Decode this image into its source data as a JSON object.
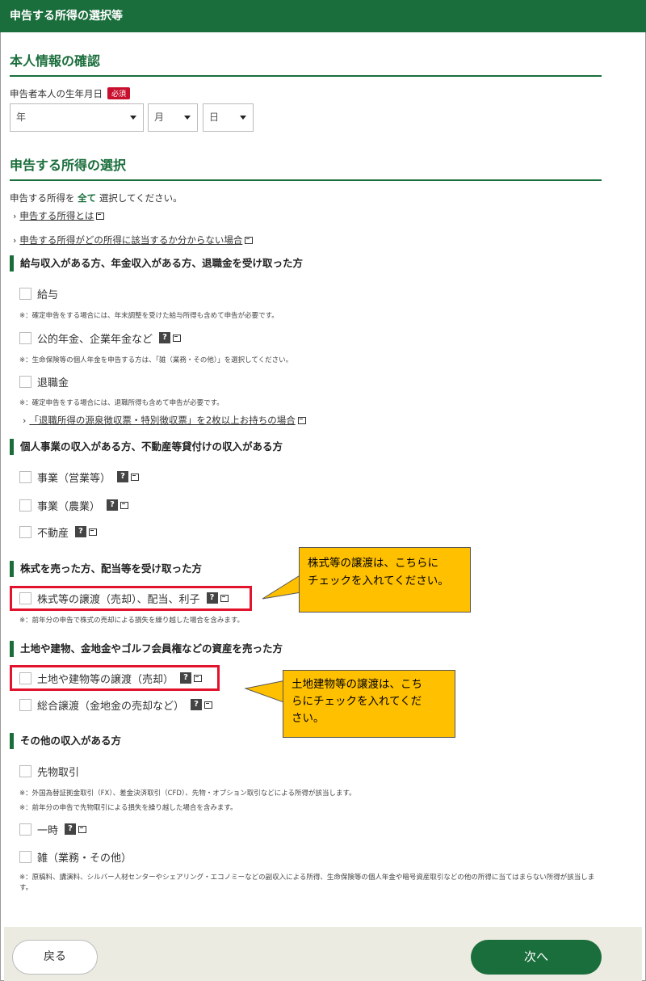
{
  "header": {
    "title": "申告する所得の選択等"
  },
  "personal": {
    "title": "本人情報の確認",
    "birth_label": "申告者本人の生年月日",
    "required_badge": "必須",
    "year_placeholder": "年",
    "month_placeholder": "月",
    "day_placeholder": "日"
  },
  "income_select": {
    "title": "申告する所得の選択",
    "instruction_prefix": "申告する所得を",
    "instruction_emph": "全て",
    "instruction_suffix": "選択してください。",
    "link1": "申告する所得とは",
    "link2": "申告する所得がどの所得に該当するか分からない場合"
  },
  "group1": {
    "heading": "給与収入がある方、年金収入がある方、退職金を受け取った方",
    "items": [
      "給与",
      "公的年金、企業年金など",
      "退職金"
    ],
    "note1": "※：確定申告をする場合には、年末調整を受けた給与所得も含めて申告が必要です。",
    "note2": "※：生命保険等の個人年金を申告する方は、「雑（業務・その他）」を選択してください。",
    "note3": "※：確定申告をする場合には、退職所得も含めて申告が必要です。",
    "link": "「退職所得の源泉徴収票・特別徴収票」を2枚以上お持ちの場合"
  },
  "group2": {
    "heading": "個人事業の収入がある方、不動産等貸付けの収入がある方",
    "items": [
      "事業（営業等）",
      "事業（農業）",
      "不動産"
    ]
  },
  "group3": {
    "heading": "株式を売った方、配当等を受け取った方",
    "items": [
      "株式等の譲渡（売却）、配当、利子"
    ],
    "note": "※：前年分の申告で株式の売却による損失を繰り越した場合を含みます。"
  },
  "group4": {
    "heading": "土地や建物、金地金やゴルフ会員権などの資産を売った方",
    "items": [
      "土地や建物等の譲渡（売却）",
      "総合譲渡（金地金の売却など）"
    ]
  },
  "group5": {
    "heading": "その他の収入がある方",
    "items": [
      "先物取引",
      "一時",
      "雑（業務・その他）"
    ],
    "note1": "※：外国為替証拠金取引（FX）、差金決済取引（CFD）、先物・オプション取引などによる所得が該当します。",
    "note2": "※：前年分の申告で先物取引による損失を繰り越した場合を含みます。",
    "note3": "※：原稿料、講演料、シルバー人材センターやシェアリング・エコノミーなどの副収入による所得、生命保険等の個人年金や暗号資産取引などの他の所得に当てはまらない所得が該当します。"
  },
  "callouts": {
    "stock_line1": "株式等の譲渡は、こちらに",
    "stock_line2": "チェックを入れてください。",
    "land_line1": "土地建物等の譲渡は、こち",
    "land_line2": "らにチェックを入れてくだ",
    "land_line3": "さい。"
  },
  "footer": {
    "back_label": "戻る",
    "next_label": "次へ"
  },
  "icons": {
    "help": "?",
    "external": "external-window-icon"
  },
  "colors": {
    "brand": "#1a6e3c",
    "required": "#c8102e",
    "highlight": "#e2142d",
    "callout": "#ffc000"
  }
}
